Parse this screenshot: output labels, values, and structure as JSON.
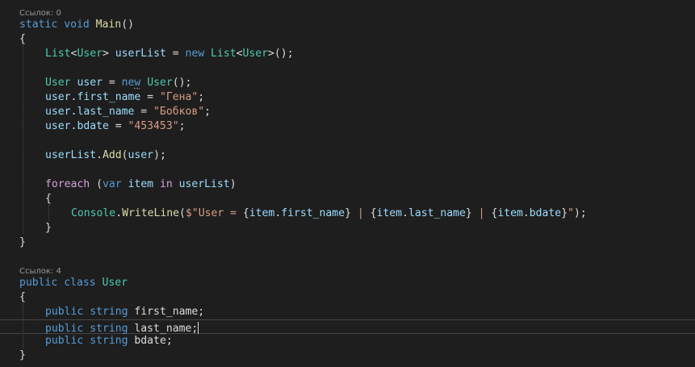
{
  "editor": {
    "codelens": {
      "main_refs": "Ссылок: 0",
      "user_refs": "Ссылок: 4"
    },
    "tokens": {
      "static": "static",
      "void": "void",
      "main_name": "Main",
      "paren_open_close": "()",
      "brace_open": "{",
      "brace_close": "}",
      "list_type": "List",
      "lt": "<",
      "gt": ">",
      "user_type": "User",
      "userlist_var": "userList",
      "eq": " = ",
      "new_kw": "new",
      "paren_close_semi": "();",
      "user_var": "user",
      "ne": "ne",
      "w": "w",
      "dot": ".",
      "first_name": "first_name",
      "last_name": "last_name",
      "bdate": "bdate",
      "str_gena": "\"Гена\"",
      "str_bobkov": "\"Бобков\"",
      "str_date": "\"453453\"",
      "semi": ";",
      "add": "Add",
      "paren_open": "(",
      "paren_close": ")",
      "paren_close_semi2": ");",
      "foreach": "foreach",
      "var_kw": "var",
      "item": "item",
      "in_kw": "in",
      "console": "Console",
      "writeline": "WriteLine",
      "interp_open": "$\"",
      "str_user_eq": "User = ",
      "brace_l": "{",
      "brace_r": "}",
      "str_pipe": " | ",
      "quote_close": "\"",
      "public": "public",
      "class": "class",
      "string": "string"
    }
  }
}
